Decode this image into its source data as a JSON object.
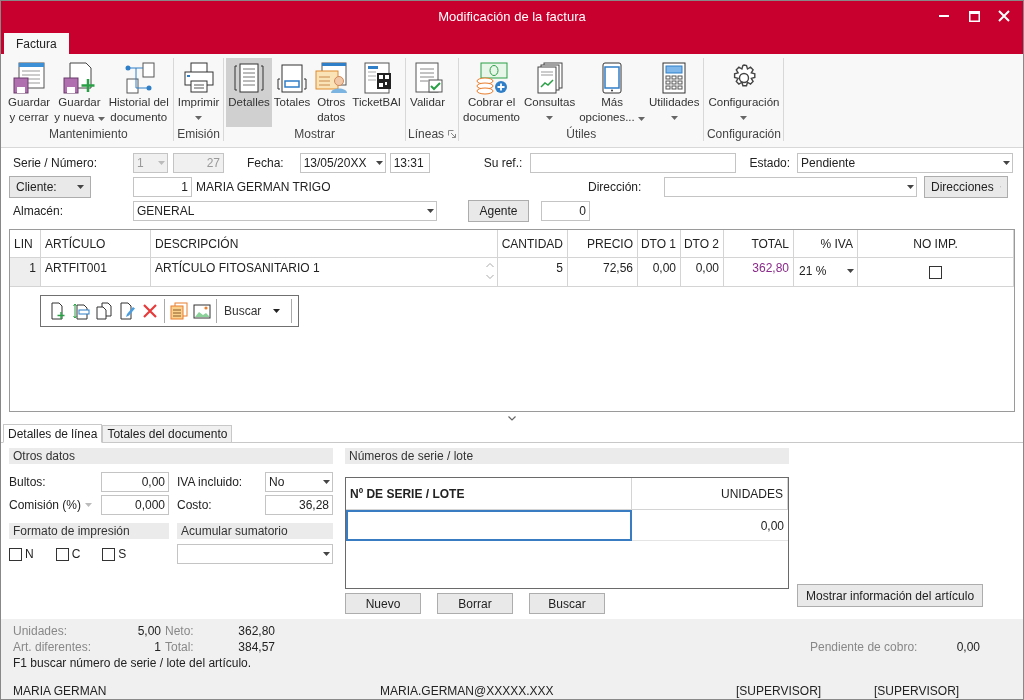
{
  "window": {
    "title": "Modificación de la factura"
  },
  "ribbon_tabs": [
    {
      "label": "Factura",
      "selected": true
    }
  ],
  "ribbon_groups": [
    {
      "label": "Mantenimiento",
      "buttons": [
        {
          "lines": [
            "Guardar",
            "y cerrar"
          ],
          "selected": false
        },
        {
          "lines": [
            "Guardar",
            "y nueva"
          ],
          "dropdown": true,
          "selected": false
        },
        {
          "lines": [
            "Historial del",
            "documento"
          ],
          "selected": false
        }
      ]
    },
    {
      "label": "Emisión",
      "buttons": [
        {
          "lines": [
            "Imprimir"
          ],
          "dropdown": true,
          "selected": false
        }
      ]
    },
    {
      "label": "Mostrar",
      "buttons": [
        {
          "lines": [
            "Detalles"
          ],
          "selected": true
        },
        {
          "lines": [
            "Totales"
          ],
          "selected": false
        },
        {
          "lines": [
            "Otros",
            "datos"
          ],
          "selected": false
        },
        {
          "lines": [
            "TicketBAI"
          ],
          "selected": false
        }
      ]
    },
    {
      "label": "Líneas",
      "launcher": true,
      "buttons": [
        {
          "lines": [
            "Validar"
          ],
          "selected": false
        }
      ]
    },
    {
      "label": "Útiles",
      "buttons": [
        {
          "lines": [
            "Cobrar el",
            "documento"
          ],
          "selected": false
        },
        {
          "lines": [
            "Consultas"
          ],
          "dropdown": true,
          "selected": false
        },
        {
          "lines": [
            "Más",
            "opciones..."
          ],
          "dropdown": true,
          "selected": false
        },
        {
          "lines": [
            "Utilidades"
          ],
          "dropdown": true,
          "selected": false
        }
      ]
    },
    {
      "label": "Configuración",
      "buttons": [
        {
          "lines": [
            "Configuración"
          ],
          "dropdown": true,
          "selected": false
        }
      ]
    }
  ],
  "header_form": {
    "serie": {
      "label": "Serie / Número:",
      "serie": "1",
      "serie_disabled": true,
      "number": "27"
    },
    "fecha": {
      "label": "Fecha:",
      "date": "13/05/20XX",
      "time": "13:31"
    },
    "su_ref": {
      "label": "Su ref.:"
    },
    "estado": {
      "label": "Estado:",
      "value": "Pendiente"
    },
    "cliente": {
      "button": "Cliente:",
      "code": "1",
      "name": "MARIA GERMAN TRIGO"
    },
    "direccion": {
      "label": "Dirección:",
      "button": "Direcciones"
    },
    "almacen": {
      "label": "Almacén:",
      "value": "GENERAL"
    },
    "agente": {
      "button": "Agente",
      "value": "0"
    }
  },
  "lines_table": {
    "columns": [
      "LIN",
      "ARTÍCULO",
      "DESCRIPCIÓN",
      "CANTIDAD",
      "PRECIO",
      "DTO 1",
      "DTO 2",
      "TOTAL",
      "% IVA",
      "NO IMP."
    ],
    "rows": [
      {
        "lin": "1",
        "articulo": "ARTFIT001",
        "descripcion": "ARTÍCULO FITOSANITARIO 1",
        "cantidad": "5",
        "precio": "72,56",
        "dto1": "0,00",
        "dto2": "0,00",
        "total": "362,80",
        "iva": "21 %",
        "no_imp": false
      }
    ]
  },
  "row_toolbar": {
    "search_label": "Buscar"
  },
  "detail_tabs": [
    {
      "label": "Detalles de línea",
      "selected": true
    },
    {
      "label": "Totales del documento",
      "selected": false
    }
  ],
  "otros_datos": {
    "title": "Otros datos",
    "bultos": {
      "label": "Bultos:",
      "value": "0,00"
    },
    "iva_incluido": {
      "label": "IVA incluido:",
      "value": "No"
    },
    "comision": {
      "label": "Comisión (%)",
      "value": "0,000"
    },
    "costo": {
      "label": "Costo:",
      "value": "36,28"
    }
  },
  "formato_impresion": {
    "title": "Formato de impresión",
    "options": [
      {
        "label": "N",
        "checked": false
      },
      {
        "label": "C",
        "checked": false
      },
      {
        "label": "S",
        "checked": false
      }
    ]
  },
  "acumular_sumatorio": {
    "title": "Acumular sumatorio"
  },
  "series": {
    "title": "Números de serie / lote",
    "columns": [
      "Nº DE SERIE / LOTE",
      "UNIDADES"
    ],
    "rows": [
      {
        "unidades": "0,00"
      }
    ],
    "buttons": [
      "Nuevo",
      "Borrar",
      "Buscar"
    ]
  },
  "info_button": "Mostrar información del artículo",
  "totals": {
    "unidades": {
      "label": "Unidades:",
      "value": "5,00"
    },
    "neto": {
      "label": "Neto:",
      "value": "362,80"
    },
    "art_diferentes": {
      "label": "Art. diferentes:",
      "value": "1"
    },
    "total": {
      "label": "Total:",
      "value": "384,57"
    },
    "pendiente": {
      "label": "Pendiente de cobro:",
      "value": "0,00"
    }
  },
  "hint": "F1 buscar número de serie / lote del artículo.",
  "status_bar": [
    "MARIA GERMAN",
    "MARIA.GERMAN@XXXXX.XXX",
    "[SUPERVISOR]",
    "[SUPERVISOR]"
  ]
}
